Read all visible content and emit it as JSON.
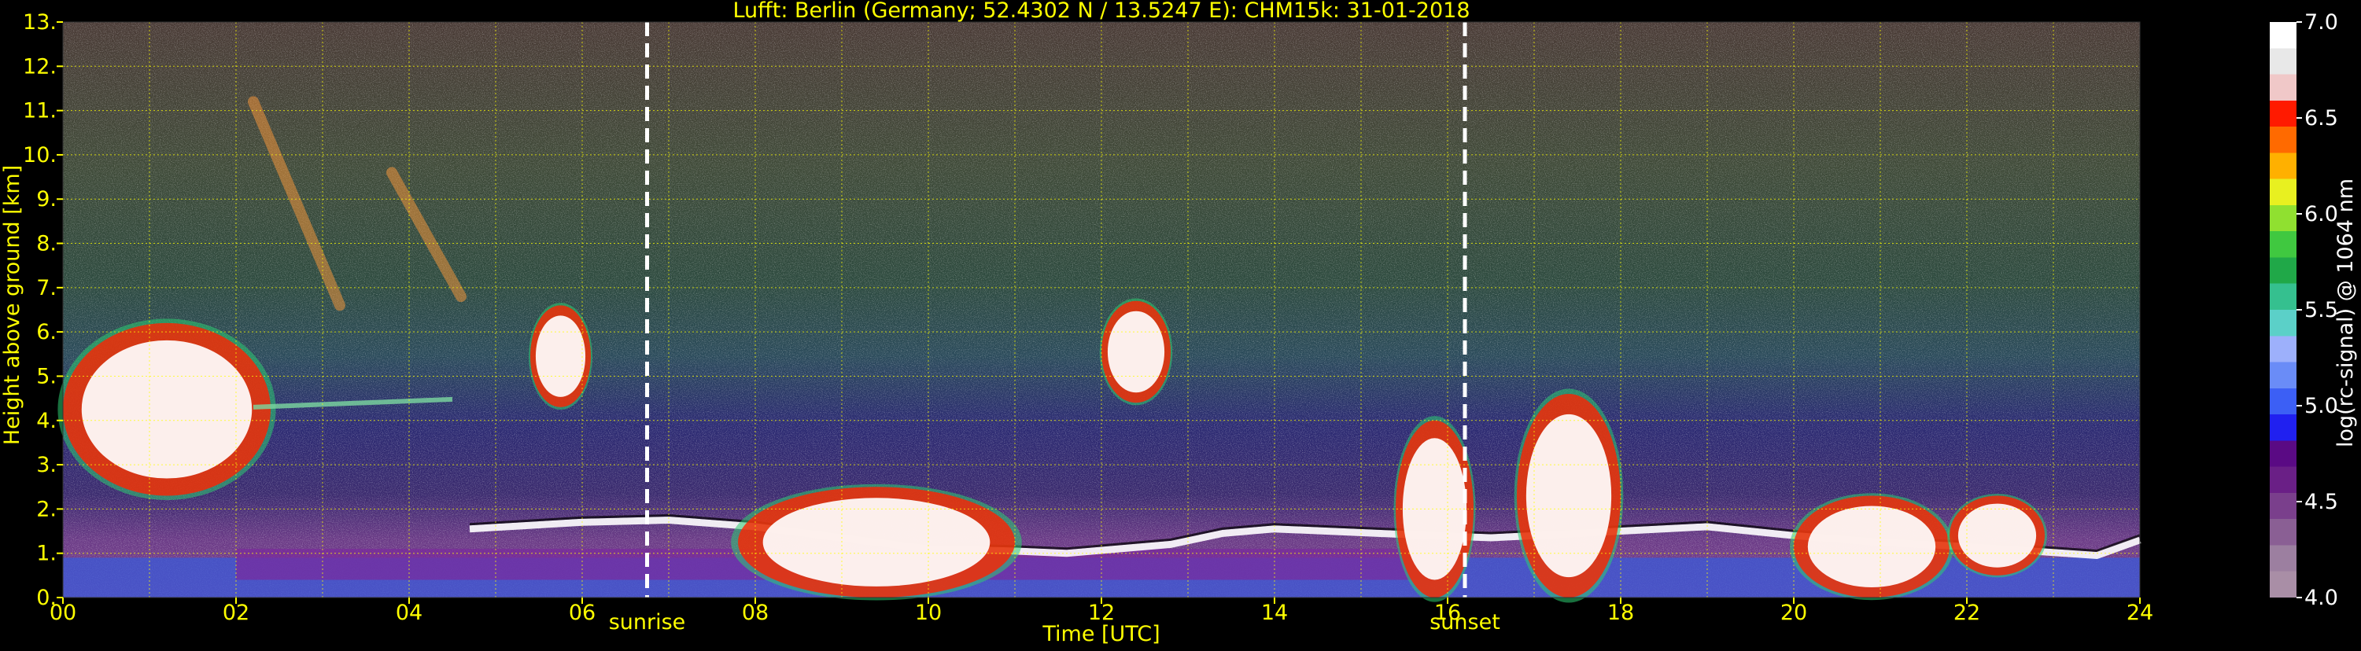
{
  "chart_data": {
    "type": "heatmap",
    "title": "Lufft: Berlin (Germany; 52.4302 N / 13.5247 E):    CHM15k: 31-01-2018",
    "xlabel": "Time [UTC]",
    "ylabel": "Height above ground [km]",
    "xlim": [
      0,
      24
    ],
    "ylim": [
      0,
      13
    ],
    "x_ticks": [
      "00",
      "02",
      "04",
      "06",
      "08",
      "10",
      "12",
      "14",
      "16",
      "18",
      "20",
      "22",
      "24"
    ],
    "y_ticks": [
      "0.",
      "1.",
      "2.",
      "3.",
      "4.",
      "5.",
      "6.",
      "7.",
      "8.",
      "9.",
      "10.",
      "11.",
      "12.",
      "13."
    ],
    "grid": true,
    "colorbar": {
      "label": "log(rc-signal) @ 1064 nm",
      "range": [
        4.0,
        7.0
      ],
      "ticks": [
        "4.0",
        "4.5",
        "5.0",
        "5.5",
        "6.0",
        "6.5",
        "7.0"
      ],
      "colors": [
        "#a98ea6",
        "#9c7fa0",
        "#8a5f94",
        "#7a3f8c",
        "#6a1f86",
        "#5a0a84",
        "#2020f0",
        "#3c5ff5",
        "#6a8cf7",
        "#9db0fb",
        "#5bd0c8",
        "#35c08f",
        "#20a848",
        "#40c840",
        "#90e030",
        "#e8f020",
        "#ffb000",
        "#ff6a00",
        "#ff1a00",
        "#f0c8c8",
        "#e8e8e8",
        "#ffffff"
      ]
    },
    "markers": [
      {
        "name": "sunrise",
        "x": 6.75
      },
      {
        "name": "sunset",
        "x": 16.2
      }
    ],
    "features": {
      "boundary_layer_top_km": [
        [
          4.7,
          1.55
        ],
        [
          6,
          1.7
        ],
        [
          7,
          1.75
        ],
        [
          8,
          1.6
        ],
        [
          9,
          1.35
        ],
        [
          10,
          1.1
        ],
        [
          11,
          1.05
        ],
        [
          11.6,
          1.0
        ],
        [
          12.8,
          1.2
        ],
        [
          13.4,
          1.45
        ],
        [
          14,
          1.55
        ],
        [
          15.2,
          1.45
        ],
        [
          16.5,
          1.35
        ],
        [
          17,
          1.4
        ],
        [
          18,
          1.5
        ],
        [
          19,
          1.6
        ],
        [
          20,
          1.4
        ],
        [
          21,
          1.25
        ],
        [
          22,
          1.15
        ],
        [
          23.5,
          0.95
        ],
        [
          24,
          1.3
        ]
      ],
      "cloud_layers": [
        {
          "t0": 0.0,
          "t1": 2.4,
          "base_km": 2.3,
          "top_km": 6.2
        },
        {
          "t0": 5.4,
          "t1": 6.1,
          "base_km": 4.3,
          "top_km": 6.6
        },
        {
          "t0": 12.0,
          "t1": 12.8,
          "base_km": 4.4,
          "top_km": 6.7
        },
        {
          "t0": 15.4,
          "t1": 16.3,
          "base_km": 0.0,
          "top_km": 4.0
        },
        {
          "t0": 16.8,
          "t1": 18.0,
          "base_km": 0.0,
          "top_km": 4.6
        },
        {
          "t0": 20.0,
          "t1": 21.8,
          "base_km": 0.0,
          "top_km": 2.3
        },
        {
          "t0": 21.8,
          "t1": 22.9,
          "base_km": 0.5,
          "top_km": 2.3
        },
        {
          "t0": 7.8,
          "t1": 11.0,
          "base_km": 0.0,
          "top_km": 2.5
        }
      ],
      "cirrus": [
        {
          "t0": 2.2,
          "t1": 3.2,
          "base_km": 6.6,
          "top_km": 11.2
        },
        {
          "t0": 3.8,
          "t1": 4.6,
          "base_km": 6.8,
          "top_km": 9.6
        }
      ],
      "thin_layer_km": {
        "t0": 2.2,
        "t1": 4.5,
        "height_km": 4.3
      }
    }
  }
}
